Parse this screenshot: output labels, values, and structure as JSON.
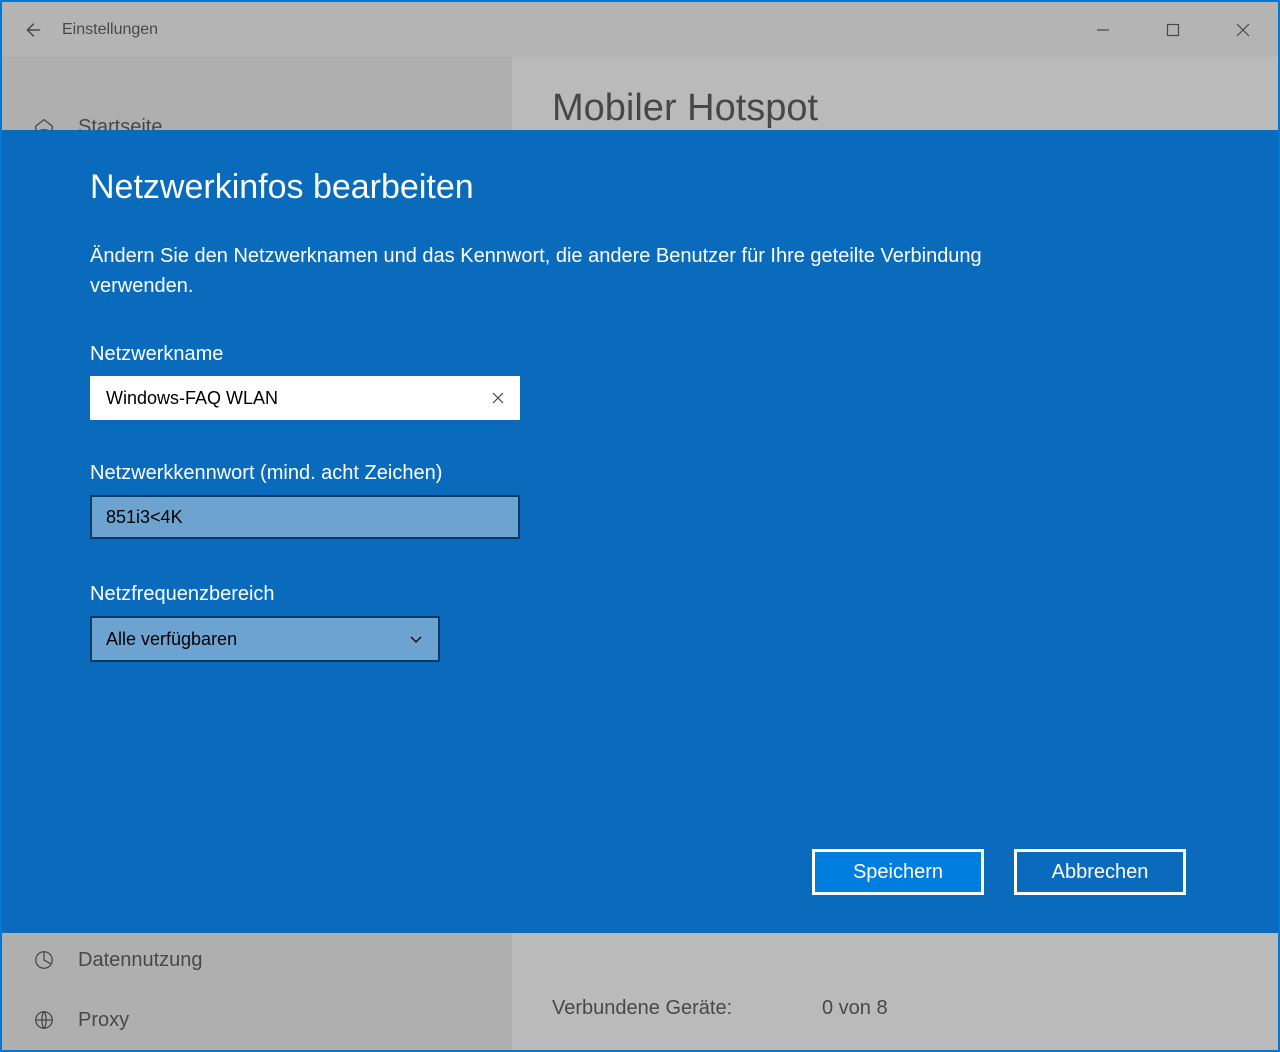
{
  "titlebar": {
    "title": "Einstellungen"
  },
  "sidebar": {
    "home": "Startseite",
    "datanutzung": "Datennutzung",
    "proxy": "Proxy"
  },
  "main": {
    "heading": "Mobiler Hotspot",
    "connected_label": "Verbundene Geräte:",
    "connected_value": "0 von 8"
  },
  "modal": {
    "title": "Netzwerkinfos bearbeiten",
    "description": "Ändern Sie den Netzwerknamen und das Kennwort, die andere Benutzer für Ihre geteilte Verbindung verwenden.",
    "name_label": "Netzwerkname",
    "name_value": "Windows-FAQ WLAN",
    "pw_label": "Netzwerkkennwort (mind. acht Zeichen)",
    "pw_value": "851i3<4K",
    "band_label": "Netzfrequenzbereich",
    "band_value": "Alle verfügbaren",
    "save": "Speichern",
    "cancel": "Abbrechen"
  }
}
